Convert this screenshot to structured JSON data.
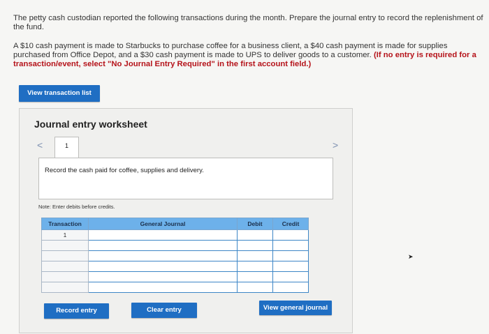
{
  "intro": "The petty cash custodian reported the following transactions during the month. Prepare the journal entry to record the replenishment of the fund.",
  "problem": {
    "text": "A $10 cash payment is made to Starbucks to purchase coffee for a business client, a $40 cash payment is made for supplies purchased from Office Depot, and a $30 cash payment is made to UPS to deliver goods to a customer.",
    "instruction": "(If no entry is required for a transaction/event, select \"No Journal Entry Required\" in the first account field.)"
  },
  "view_transaction_list_label": "View transaction list",
  "worksheet": {
    "title": "Journal entry worksheet",
    "prev_icon": "chevron-left-icon",
    "next_icon": "chevron-right-icon",
    "prev_glyph": "<",
    "next_glyph": ">",
    "tab_label": "1",
    "instruction": "Record the cash paid for coffee, supplies and delivery.",
    "note": "Note: Enter debits before credits."
  },
  "journal": {
    "columns": [
      "Transaction",
      "General Journal",
      "Debit",
      "Credit"
    ],
    "rows": [
      {
        "transaction": "1"
      },
      {
        "transaction": ""
      },
      {
        "transaction": ""
      },
      {
        "transaction": ""
      },
      {
        "transaction": ""
      },
      {
        "transaction": ""
      }
    ]
  },
  "buttons": {
    "record": "Record entry",
    "clear": "Clear entry",
    "view_general_journal": "View general journal"
  },
  "colors": {
    "button": "#1f6ec3",
    "header": "#6db1ea",
    "instruction_red": "#b5131a"
  }
}
